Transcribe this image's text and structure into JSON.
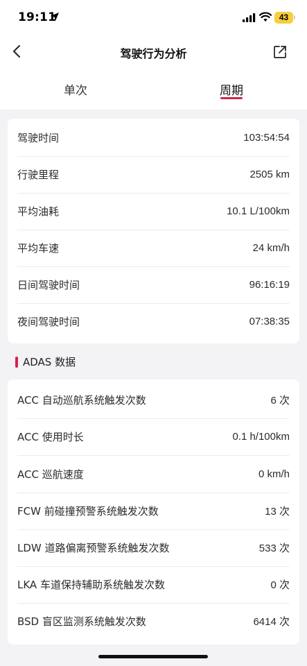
{
  "status_bar": {
    "time": "19:11",
    "battery": "43"
  },
  "header": {
    "title": "驾驶行为分析"
  },
  "tabs": [
    {
      "label": "单次",
      "active": false
    },
    {
      "label": "周期",
      "active": true
    }
  ],
  "accent_color": "#d1244a",
  "driving_stats": [
    {
      "label": "驾驶时间",
      "value": "103:54:54"
    },
    {
      "label": "行驶里程",
      "value": "2505 km"
    },
    {
      "label": "平均油耗",
      "value": "10.1 L/100km"
    },
    {
      "label": "平均车速",
      "value": "24 km/h"
    },
    {
      "label": "日间驾驶时间",
      "value": "96:16:19"
    },
    {
      "label": "夜间驾驶时间",
      "value": "07:38:35"
    }
  ],
  "adas": {
    "title": "ADAS 数据",
    "items": [
      {
        "label": "ACC 自动巡航系统触发次数",
        "value": "6 次"
      },
      {
        "label": "ACC 使用时长",
        "value": "0.1 h/100km"
      },
      {
        "label": "ACC 巡航速度",
        "value": "0 km/h"
      },
      {
        "label": "FCW 前碰撞预警系统触发次数",
        "value": "13 次"
      },
      {
        "label": "LDW 道路偏离预警系统触发次数",
        "value": "533 次"
      },
      {
        "label": "LKA 车道保持辅助系统触发次数",
        "value": "0 次"
      },
      {
        "label": "BSD 盲区监测系统触发次数",
        "value": "6414 次"
      }
    ]
  }
}
